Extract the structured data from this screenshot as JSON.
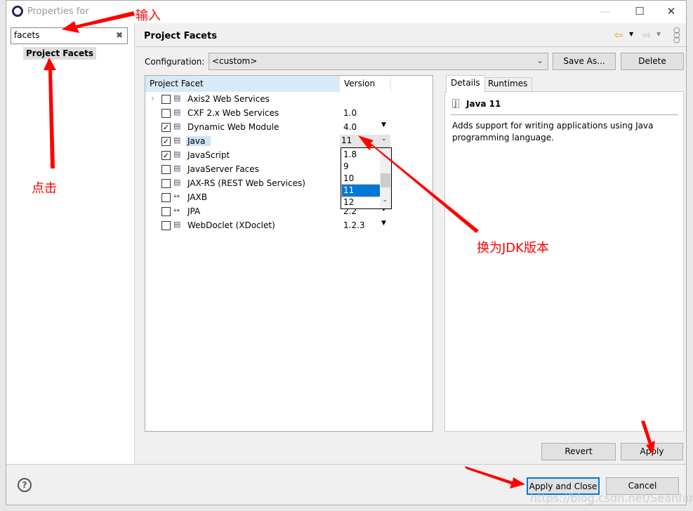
{
  "window": {
    "title": "Properties for",
    "minimize": "—",
    "maximize": "☐",
    "close": "✕"
  },
  "sidebar": {
    "search_value": "facets",
    "clear_icon": "✖",
    "items": [
      {
        "label": "Project Facets"
      }
    ]
  },
  "header": {
    "title": "Project Facets",
    "nav_icons": [
      "back-arrow-icon",
      "forward-arrow-icon",
      "more-icon"
    ]
  },
  "configuration": {
    "label": "Configuration:",
    "value": "<custom>",
    "save_as": "Save As...",
    "delete": "Delete"
  },
  "table": {
    "headers": [
      "Project Facet",
      "Version"
    ],
    "rows": [
      {
        "name": "Axis2 Web Services",
        "version": "",
        "checked": false,
        "dropdown": false,
        "expand": true
      },
      {
        "name": "CXF 2.x Web Services",
        "version": "1.0",
        "checked": false,
        "dropdown": false
      },
      {
        "name": "Dynamic Web Module",
        "version": "4.0",
        "checked": true,
        "dropdown": true
      },
      {
        "name": "Java",
        "version": "11",
        "checked": true,
        "dropdown": true,
        "selected": true
      },
      {
        "name": "JavaScript",
        "version": "",
        "checked": true,
        "dropdown": false
      },
      {
        "name": "JavaServer Faces",
        "version": "",
        "checked": false,
        "dropdown": false
      },
      {
        "name": "JAX-RS (REST Web Services)",
        "version": "",
        "checked": false,
        "dropdown": false
      },
      {
        "name": "JAXB",
        "version": "",
        "checked": false,
        "dropdown": false
      },
      {
        "name": "JPA",
        "version": "2.2",
        "checked": false,
        "dropdown": true
      },
      {
        "name": "WebDoclet (XDoclet)",
        "version": "1.2.3",
        "checked": false,
        "dropdown": true
      }
    ]
  },
  "version_dropdown": {
    "options": [
      "1.8",
      "9",
      "10",
      "11",
      "12"
    ],
    "selected": "11"
  },
  "details": {
    "tabs": [
      "Details",
      "Runtimes"
    ],
    "title": "Java 11",
    "description": "Adds support for writing applications using Java programming language."
  },
  "buttons": {
    "revert": "Revert",
    "apply": "Apply",
    "apply_close": "Apply and Close",
    "cancel": "Cancel",
    "help": "?"
  },
  "annotations": {
    "input": "输入",
    "click": "点击",
    "change_jdk": "换为JDK版本"
  },
  "watermark": "https://blog.csdn.net/SeanfanJo",
  "colors": {
    "selection": "#0078d7",
    "annotation": "#ff0000",
    "header_highlight": "#d9eaf7"
  }
}
